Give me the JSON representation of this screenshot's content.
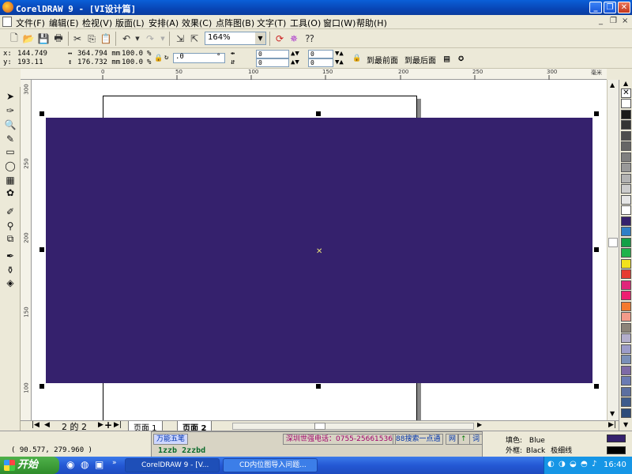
{
  "window": {
    "title": "CorelDRAW 9 - [VI设计篇]",
    "minimize": "_",
    "restore": "❐",
    "close": "✕"
  },
  "menu": {
    "items": [
      "文件(F)",
      "编辑(E)",
      "检视(V)",
      "版面(L)",
      "安排(A)",
      "效果(C)",
      "点阵图(B)",
      "文字(T)",
      "工具(O)",
      "窗口(W)",
      "帮助(H)"
    ],
    "mdi": [
      "_",
      "❐",
      "×"
    ]
  },
  "toolbar": {
    "zoom_value": "164%"
  },
  "property_bar": {
    "x": "144.749",
    "y": "193.11",
    "width": "364.794 mm",
    "height": "176.732 mm",
    "scale_x": "100.0",
    "scale_y": "100.0",
    "percent": "%",
    "rotation": ".0",
    "degree": "°",
    "corner_values": [
      "0",
      "0",
      "0",
      "0"
    ],
    "to_front": "到最前面",
    "to_back": "到最后面"
  },
  "rulers": {
    "unit": "毫米",
    "top_ticks": [
      "0",
      "50",
      "100",
      "150",
      "200",
      "250",
      "300"
    ],
    "left_ticks": [
      "300",
      "250",
      "200",
      "150",
      "100"
    ]
  },
  "page_nav": {
    "counter": "2 的 2",
    "tabs": [
      "页面 1",
      "页面 2"
    ],
    "add_page": "+"
  },
  "palette": {
    "colors": [
      "#ffffff",
      "#1a1a1a",
      "#333333",
      "#4d4d4d",
      "#666666",
      "#808080",
      "#999999",
      "#b3b3b3",
      "#cccccc",
      "#e6e6e6",
      "#ffffff",
      "#35216d",
      "#2f7fc7",
      "#14a046",
      "#1fb34a",
      "#f2e21b",
      "#e63a2f",
      "#e0267a",
      "#ee1f71",
      "#f47a2d",
      "#f39b8a",
      "#8c8478",
      "#b3aecb",
      "#9c9cc9",
      "#7a8fb8",
      "#7e6aa6",
      "#6b7bb3",
      "#5c6fa0",
      "#3e5c8c",
      "#2d4c7a"
    ]
  },
  "status": {
    "coords": "( 90.577, 279.960 )",
    "fill_label": "填色:",
    "fill_value": "Blue",
    "outline_label": "外框:",
    "outline_value": "Black",
    "outline_width": "极细线"
  },
  "ime": {
    "name": "万能五笔",
    "ad": "深圳世强电话：0755-25661536",
    "search": "88搜索一点通",
    "net": "网",
    "arrow": "↑",
    "word": "词",
    "composition": "1zzb 2zzbd"
  },
  "taskbar": {
    "start": "开始",
    "tasks": [
      "CorelDRAW 9 - [V...",
      "CD内位图导入问题..."
    ],
    "clock": "16:40"
  },
  "colors": {
    "shape_fill": "#35216d",
    "accent": "#0a5fd8"
  }
}
